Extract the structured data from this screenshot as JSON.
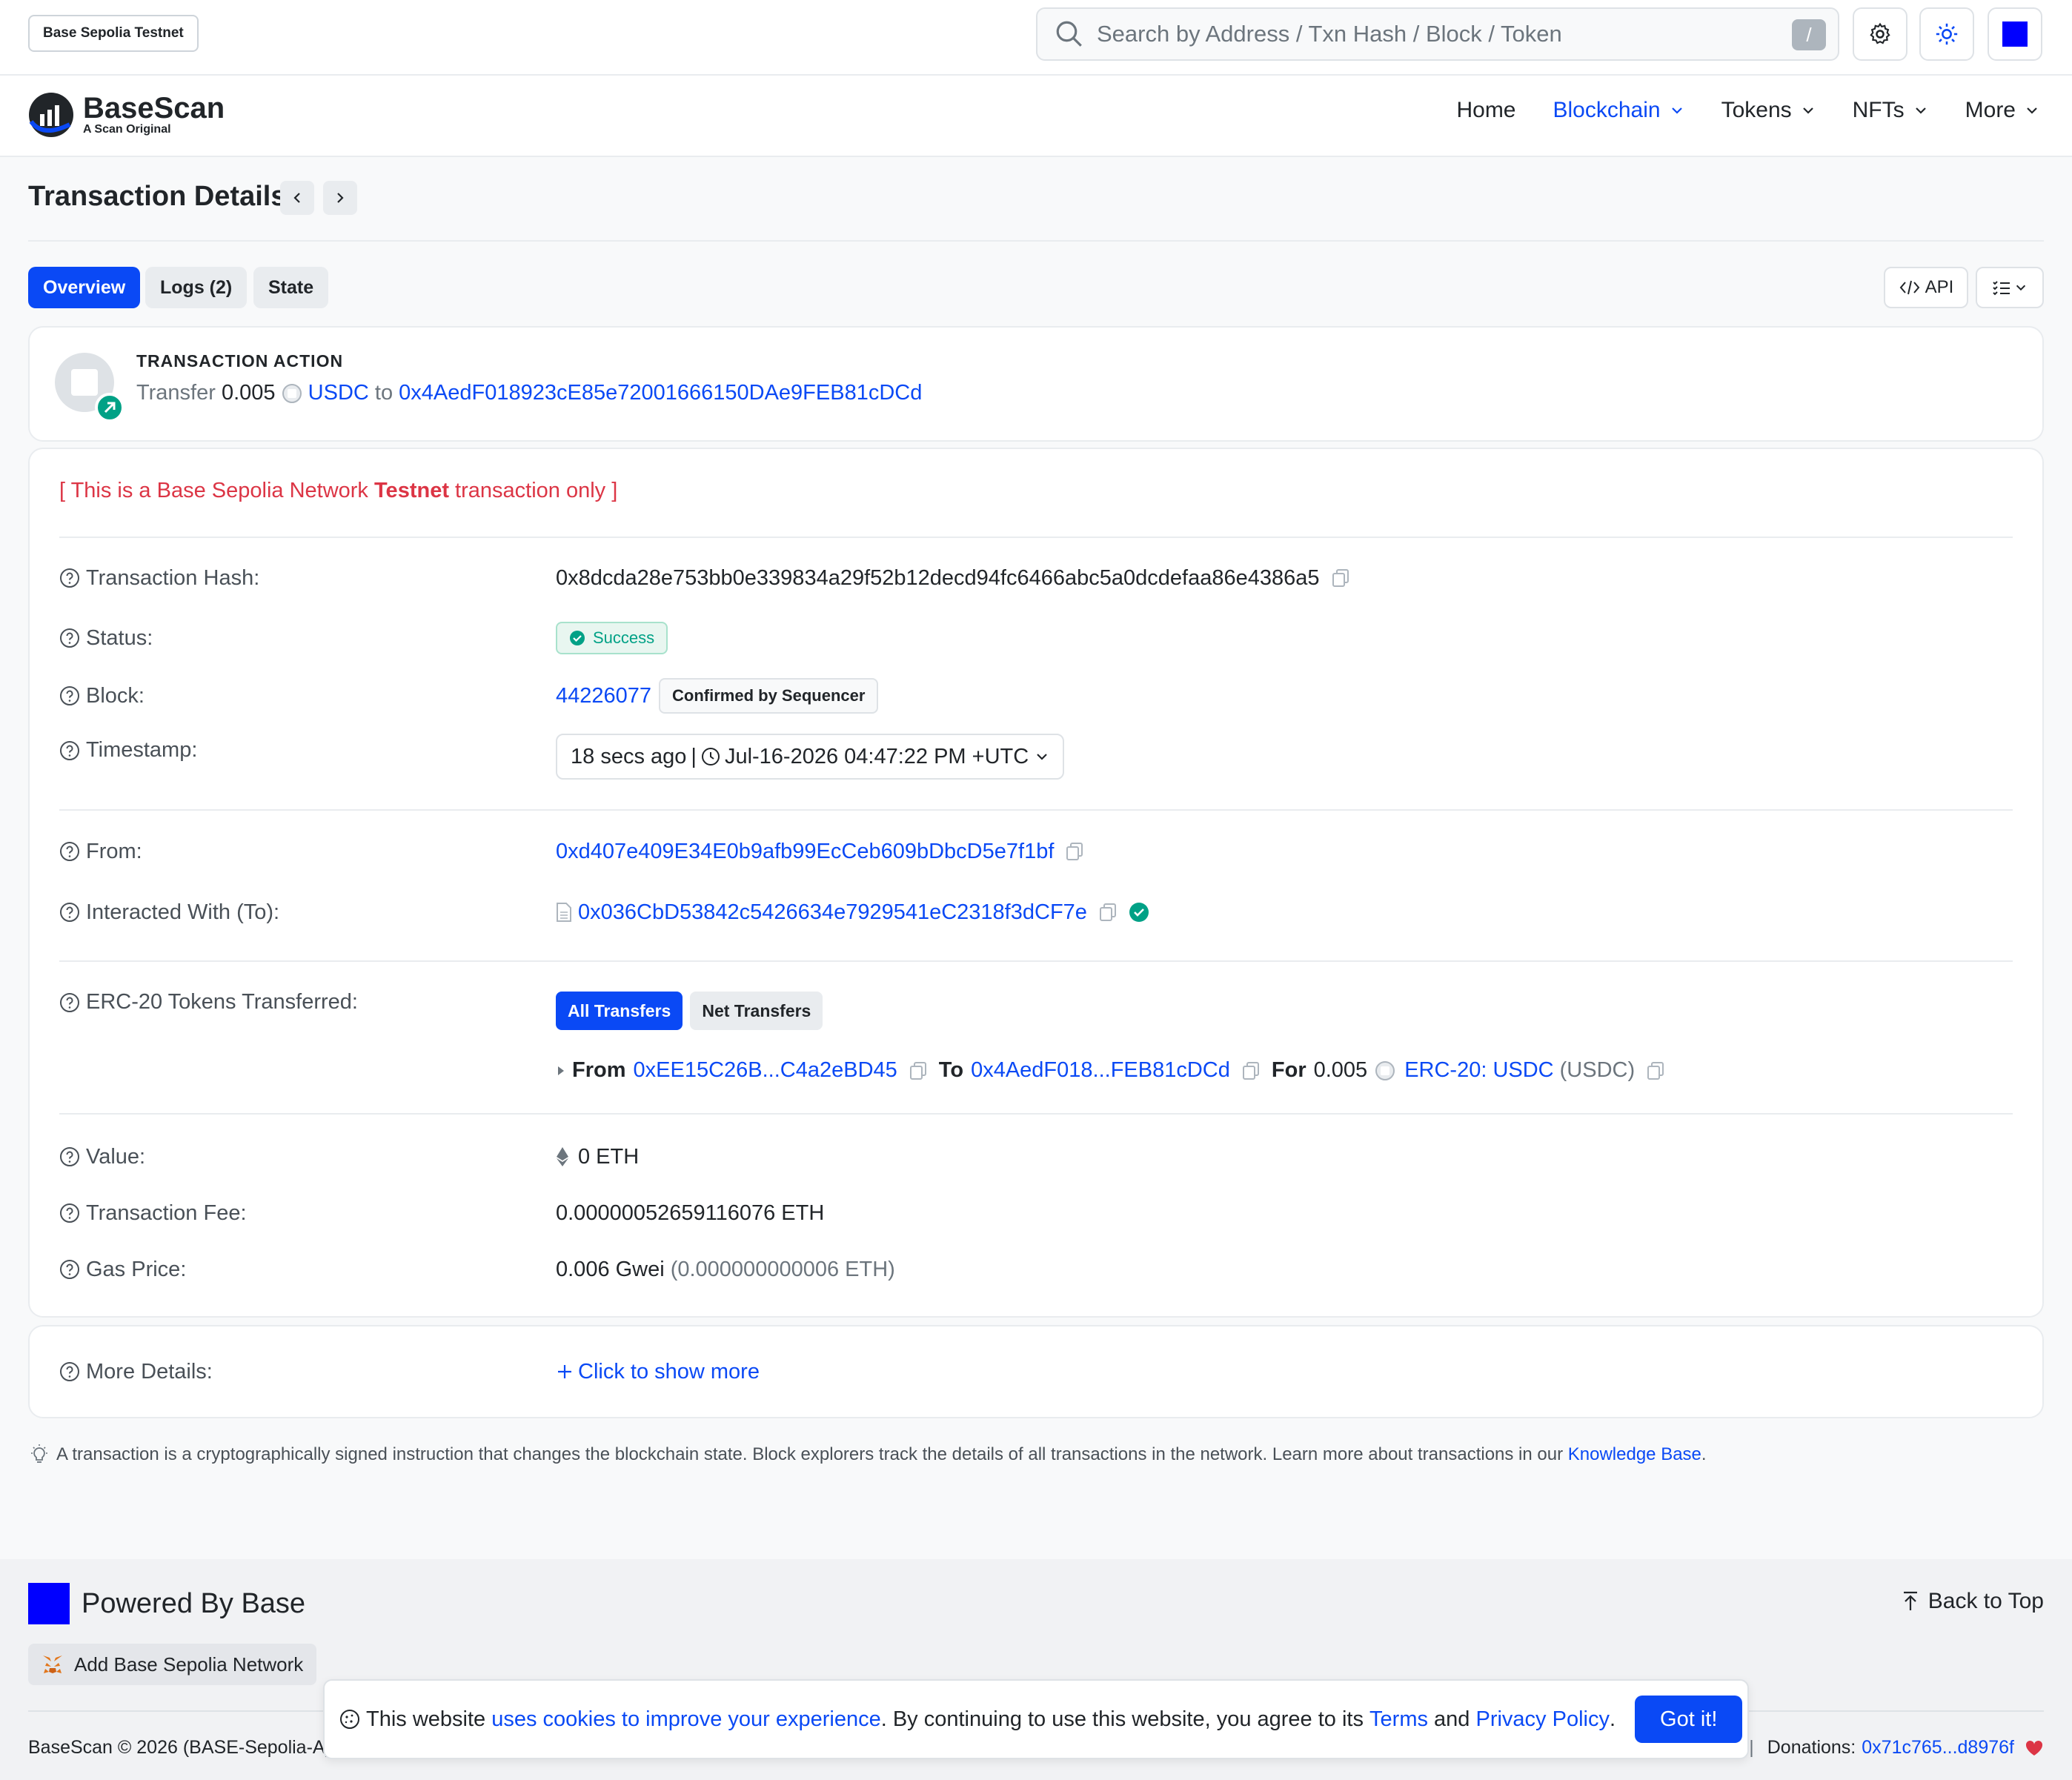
{
  "topbar": {
    "network_label": "Base Sepolia Testnet",
    "search_placeholder": "Search by Address / Txn Hash / Block / Token",
    "search_shortcut": "/"
  },
  "brand": {
    "name": "BaseScan",
    "tagline": "A Scan Original"
  },
  "nav": {
    "home": "Home",
    "blockchain": "Blockchain",
    "tokens": "Tokens",
    "nfts": "NFTs",
    "more": "More"
  },
  "page": {
    "title": "Transaction Details"
  },
  "tabs": {
    "overview": "Overview",
    "logs": "Logs (2)",
    "state": "State",
    "api": "API"
  },
  "action": {
    "title": "TRANSACTION ACTION",
    "verb": "Transfer",
    "amount": "0.005",
    "token": "USDC",
    "to_word": "to",
    "to_address": "0x4AedF018923cE85e72001666150DAe9FEB81cDCd"
  },
  "notice": {
    "prefix": "[ This is a Base Sepolia Network ",
    "bold": "Testnet",
    "suffix": " transaction only ]"
  },
  "details": {
    "hash_label": "Transaction Hash:",
    "hash": "0x8dcda28e753bb0e339834a29f52b12decd94fc6466abc5a0dcdefaa86e4386a5",
    "status_label": "Status:",
    "status": "Success",
    "block_label": "Block:",
    "block": "44226077",
    "block_badge": "Confirmed by Sequencer",
    "timestamp_label": "Timestamp:",
    "timestamp_ago": "18 secs ago",
    "timestamp_sep": "|",
    "timestamp_full": "Jul-16-2026 04:47:22 PM +UTC",
    "from_label": "From:",
    "from": "0xd407e409E34E0b9afb99EcCeb609bDbcD5e7f1bf",
    "to_label": "Interacted With (To):",
    "to": "0x036CbD53842c5426634e7929541eC2318f3dCF7e",
    "erc20_label": "ERC-20 Tokens Transferred:",
    "all_transfers": "All Transfers",
    "net_transfers": "Net Transfers",
    "transfer": {
      "from_word": "From",
      "from": "0xEE15C26B...C4a2eBD45",
      "to_word": "To",
      "to": "0x4AedF018...FEB81cDCd",
      "for_word": "For",
      "amount": "0.005",
      "token": "ERC-20: USDC",
      "symbol": "(USDC)"
    },
    "value_label": "Value:",
    "value": "0 ETH",
    "fee_label": "Transaction Fee:",
    "fee": "0.00000052659116076 ETH",
    "gas_label": "Gas Price:",
    "gas": "0.006 Gwei",
    "gas_eth": "(0.000000000006 ETH)"
  },
  "more": {
    "label": "More Details:",
    "link": "Click to show more"
  },
  "info": {
    "text": "A transaction is a cryptographically signed instruction that changes the blockchain state. Block explorers track the details of all transactions in the network. Learn more about transactions in our ",
    "link": "Knowledge Base",
    "end": "."
  },
  "footer": {
    "powered": "Powered By Base",
    "back_to_top": "Back to Top",
    "add_network": "Add Base Sepolia Network",
    "copyright": "BaseScan © 2026 (BASE-Sepolia-A)",
    "pipe": "|",
    "donations_label": "Donations:",
    "donations_address": "0x71c765...d8976f"
  },
  "cookie": {
    "pre": "This website ",
    "link1": "uses cookies to improve your experience",
    "mid": ". By continuing to use this website, you agree to its ",
    "terms": "Terms",
    "and": " and ",
    "privacy": "Privacy Policy",
    "end": ".",
    "button": "Got it!"
  },
  "colors": {
    "accent": "#0A49F5",
    "success": "#00a186",
    "danger": "#dc3545",
    "brand_square": "#0000FF"
  }
}
